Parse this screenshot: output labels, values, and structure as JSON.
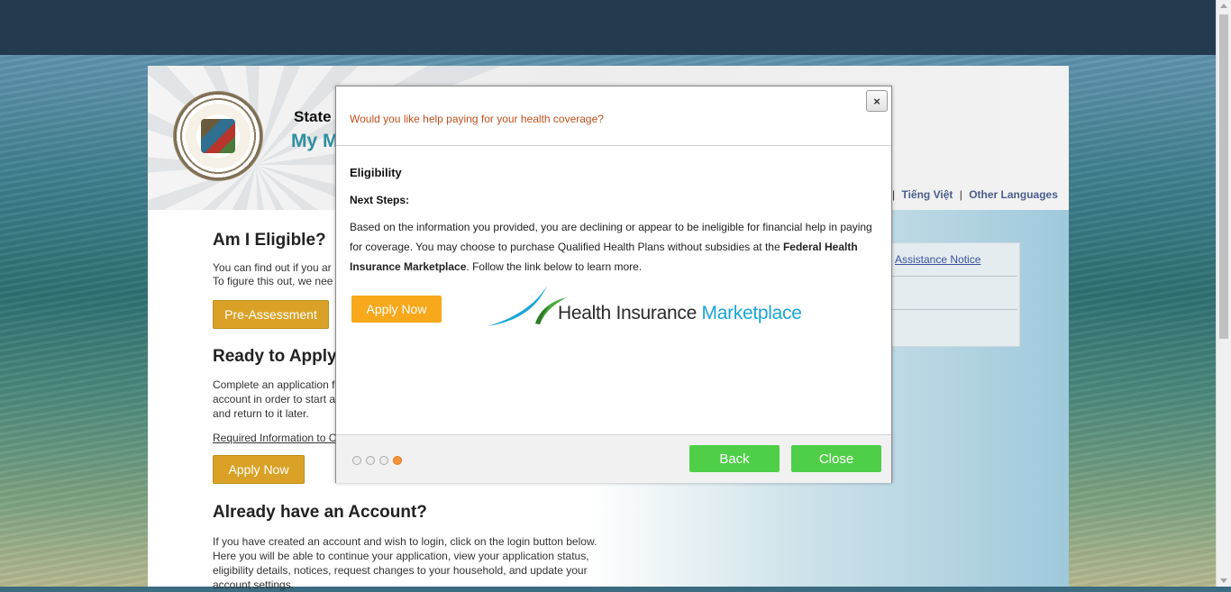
{
  "header": {
    "state_label": "State",
    "site_label": "My M",
    "languages": [
      "Tiếng Việt",
      "Other Languages"
    ]
  },
  "left": {
    "eligible_heading": "Am I Eligible?",
    "eligible_text": "You can find out if you ar To figure this out, we nee",
    "preassessment_label": "Pre-Assessment",
    "ready_heading": "Ready to Apply",
    "ready_text": "Complete an application f account in order to start a and return to it later.",
    "required_link": "Required Information to C",
    "apply_label": "Apply Now",
    "already_heading": "Already have an Account?",
    "already_text": "If you have created an account and wish to login, click on the login button below. Here you will be able to continue your application, view your application status, eligibility details, notices, request changes to your household, and update your account settings."
  },
  "right": {
    "notice_link": "Assistance Notice"
  },
  "modal": {
    "close_symbol": "×",
    "question": "Would you like help paying for your health coverage?",
    "heading": "Eligibility",
    "next_steps": "Next Steps:",
    "body_part1": "Based on the information you provided, you are declining or appear to be ineligible for financial help in paying for coverage. You may choose to purchase Qualified Health Plans without subsidies at the ",
    "body_bold": "Federal Health Insurance Marketplace",
    "body_part2": ". Follow the link below to learn more.",
    "apply_label": "Apply Now",
    "logo_text_dark": "Health Insurance",
    "logo_text_blue": "Marketplace",
    "step_current": 4,
    "step_total": 4,
    "back_label": "Back",
    "close_label": "Close"
  },
  "colors": {
    "accent_orange": "#f7a81b",
    "green_button": "#4fcf48",
    "question_text": "#c0501e",
    "marketplace_blue": "#1aa5d8"
  }
}
